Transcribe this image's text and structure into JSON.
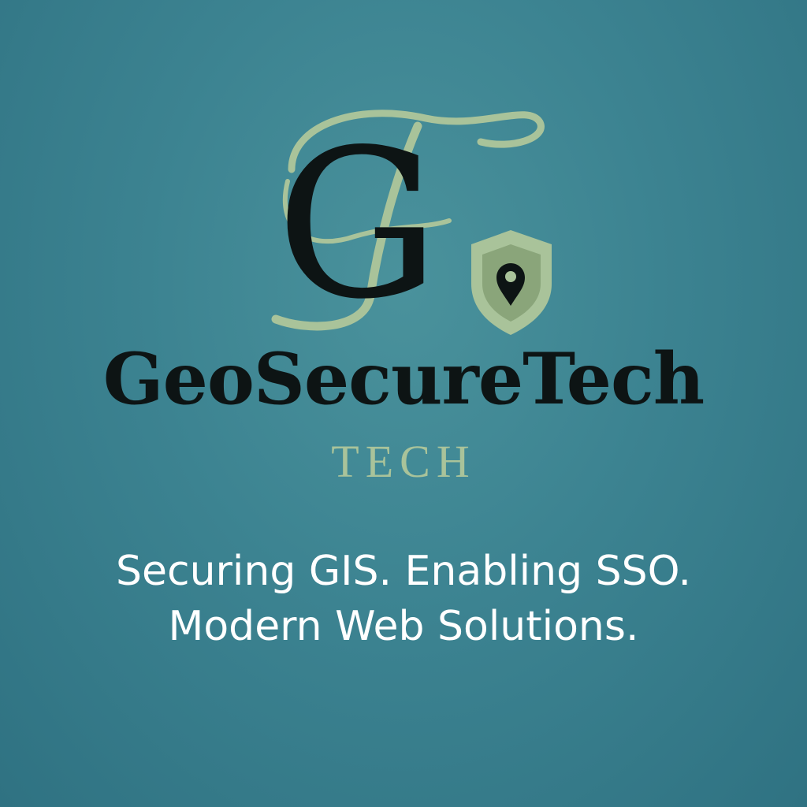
{
  "logo": {
    "monogram_letter": "G",
    "icons": [
      "monogram-icon",
      "shield-location-icon"
    ],
    "colors": {
      "dark": "#0d1414",
      "sage": "#a9c39a",
      "shield_inner": "#8aa57a",
      "background": "#3c8391"
    }
  },
  "brand": {
    "name": "GeoSecureTech",
    "subtitle": "TECH"
  },
  "tagline": {
    "line1": "Securing GIS. Enabling SSO.",
    "line2": "Modern Web Solutions."
  }
}
